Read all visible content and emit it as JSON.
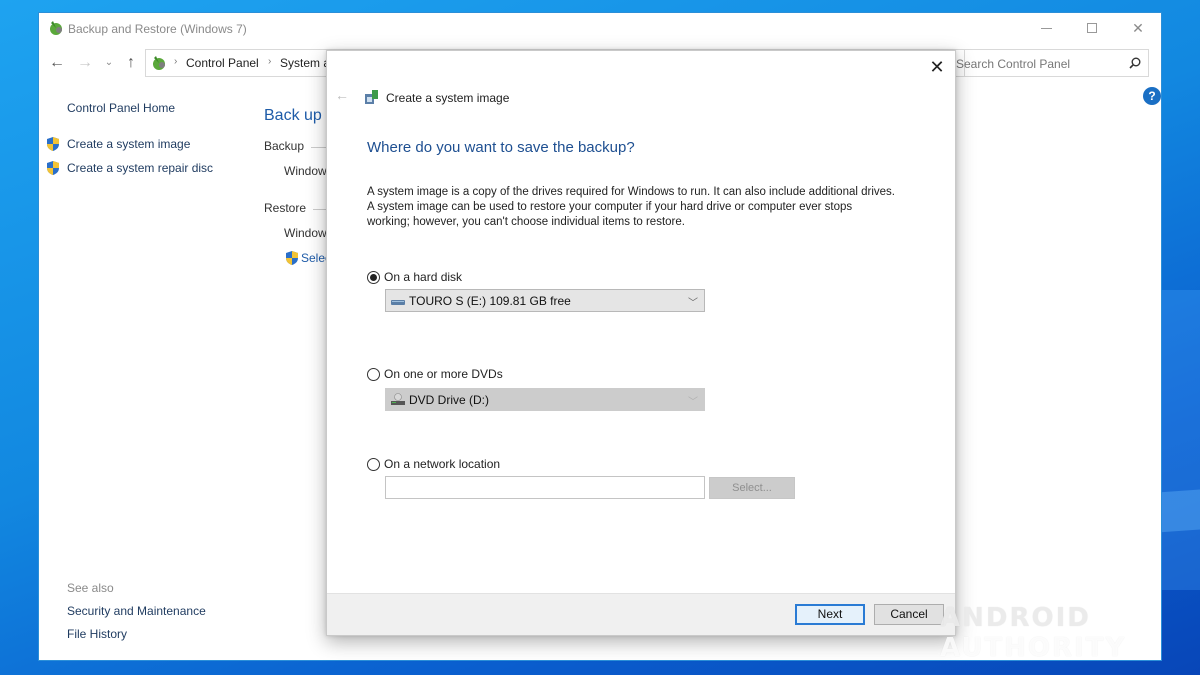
{
  "window": {
    "title": "Backup and Restore (Windows 7)",
    "controls": {
      "minimize": "minimize",
      "maximize": "maximize",
      "close": "close"
    }
  },
  "navbar": {
    "breadcrumb": [
      "Control Panel",
      "System a"
    ],
    "search_placeholder": "Search Control Panel",
    "help_label": "?"
  },
  "sidebar": {
    "home": "Control Panel Home",
    "tasks": [
      {
        "label": "Create a system image",
        "icon": "uac-shield-icon"
      },
      {
        "label": "Create a system repair disc",
        "icon": "uac-shield-icon"
      }
    ],
    "see_also_label": "See also",
    "see_also": [
      "Security and Maintenance",
      "File History"
    ]
  },
  "main": {
    "heading": "Back up c",
    "backup_label": "Backup",
    "backup_text": "Window",
    "restore_label": "Restore",
    "restore_text": "Window",
    "select_link": "Selec"
  },
  "dialog": {
    "title": "Create a system image",
    "heading": "Where do you want to save the backup?",
    "description": "A system image is a copy of the drives required for Windows to run. It can also include additional drives. A system image can be used to restore your computer if your hard drive or computer ever stops working; however, you can't choose individual items to restore.",
    "options": [
      {
        "label": "On a hard disk",
        "selected": true,
        "value": "TOURO S (E:)  109.81 GB free",
        "enabled": true
      },
      {
        "label": "On one or more DVDs",
        "selected": false,
        "value": "DVD Drive (D:)",
        "enabled": false
      },
      {
        "label": "On a network location",
        "selected": false,
        "value": "",
        "enabled": false
      }
    ],
    "select_button": "Select...",
    "next_button": "Next",
    "cancel_button": "Cancel"
  },
  "watermark": {
    "part1": "ANDROID",
    "part2": "AUTHORITY"
  }
}
